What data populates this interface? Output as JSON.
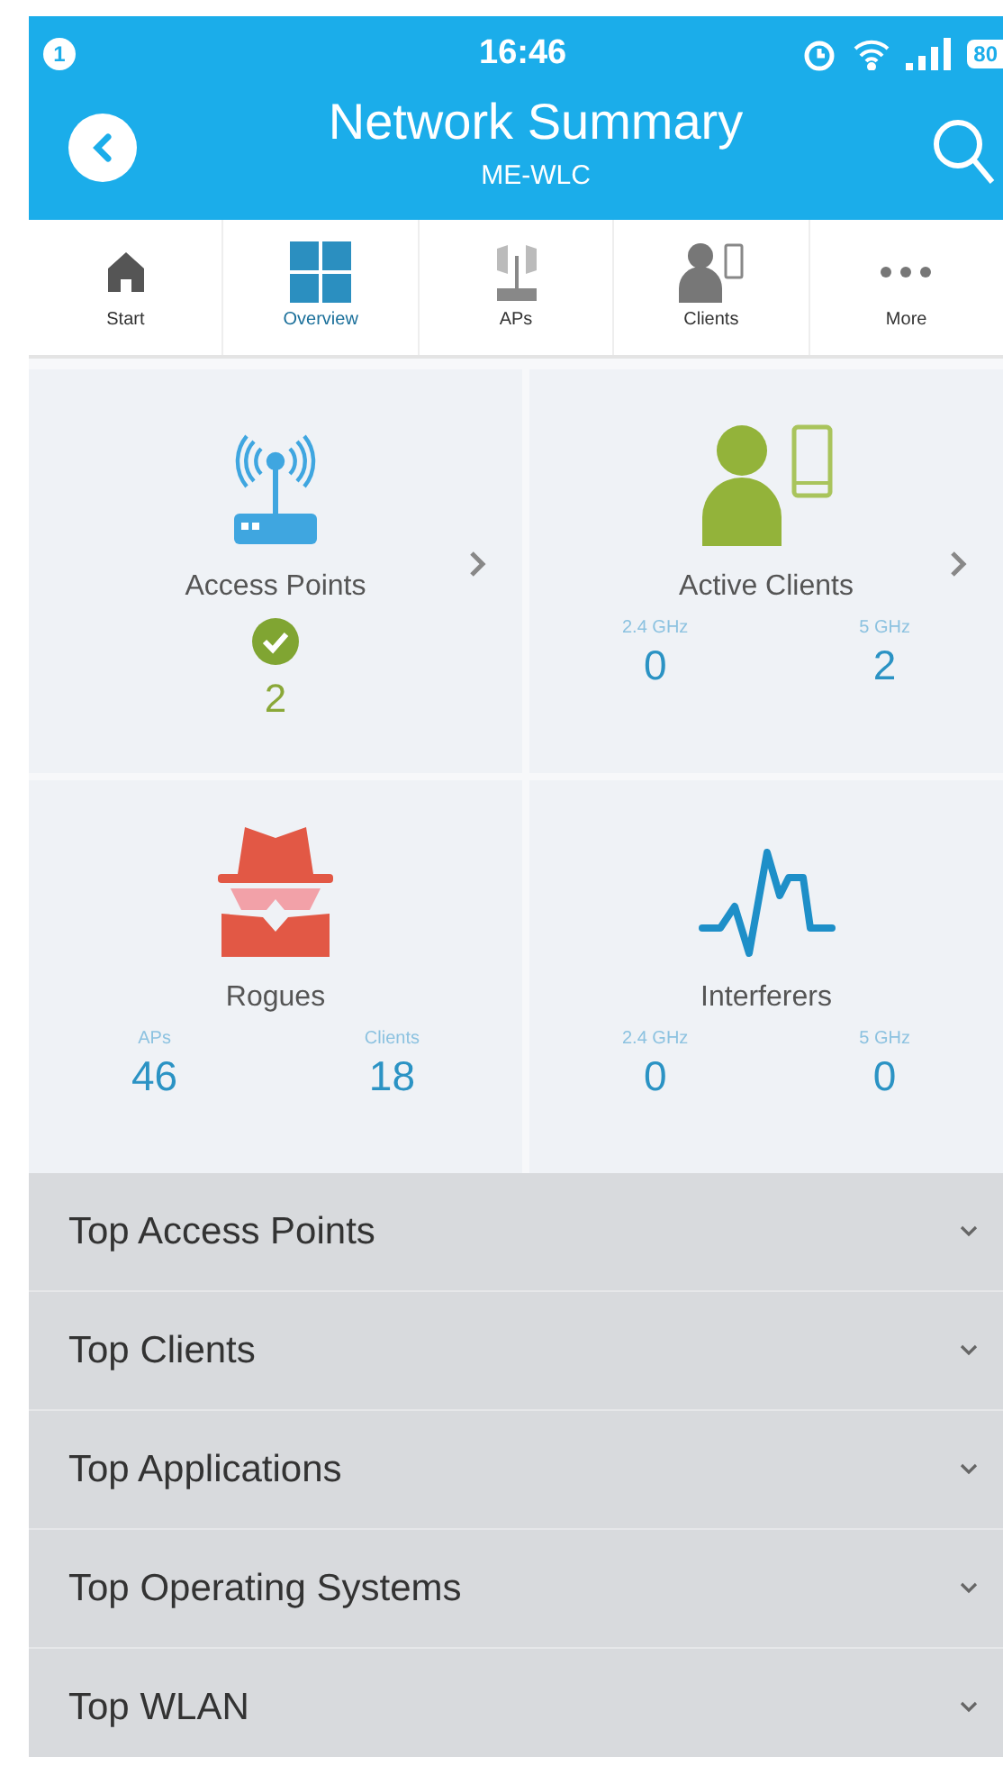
{
  "status_bar": {
    "notification_count": "1",
    "time": "16:46",
    "battery": "80"
  },
  "header": {
    "title": "Network Summary",
    "subtitle": "ME-WLC"
  },
  "tabs": [
    {
      "label": "Start",
      "kind": "home",
      "selected": false
    },
    {
      "label": "Overview",
      "kind": "grid",
      "selected": true
    },
    {
      "label": "APs",
      "kind": "ap",
      "selected": false
    },
    {
      "label": "Clients",
      "kind": "client",
      "selected": false
    },
    {
      "label": "More",
      "kind": "more",
      "selected": false
    }
  ],
  "tiles": [
    {
      "title": "Access Points",
      "kind": "ap",
      "chevron": true,
      "value": "2"
    },
    {
      "title": "Active Clients",
      "kind": "client",
      "chevron": true,
      "stats": [
        {
          "label": "2.4 GHz",
          "value": "0"
        },
        {
          "label": "5 GHz",
          "value": "2"
        }
      ]
    },
    {
      "title": "Rogues",
      "kind": "rogue",
      "chevron": false,
      "stats": [
        {
          "label": "APs",
          "value": "46"
        },
        {
          "label": "Clients",
          "value": "18"
        }
      ]
    },
    {
      "title": "Interferers",
      "kind": "wave",
      "chevron": false,
      "stats": [
        {
          "label": "2.4 GHz",
          "value": "0"
        },
        {
          "label": "5 GHz",
          "value": "0"
        }
      ]
    }
  ],
  "sections": [
    {
      "title": "Top Access Points",
      "expanded": false
    },
    {
      "title": "Top Clients",
      "expanded": false
    },
    {
      "title": "Top Applications",
      "expanded": false
    },
    {
      "title": "Top Operating Systems",
      "expanded": false
    },
    {
      "title": "Top WLAN",
      "expanded": false
    }
  ]
}
